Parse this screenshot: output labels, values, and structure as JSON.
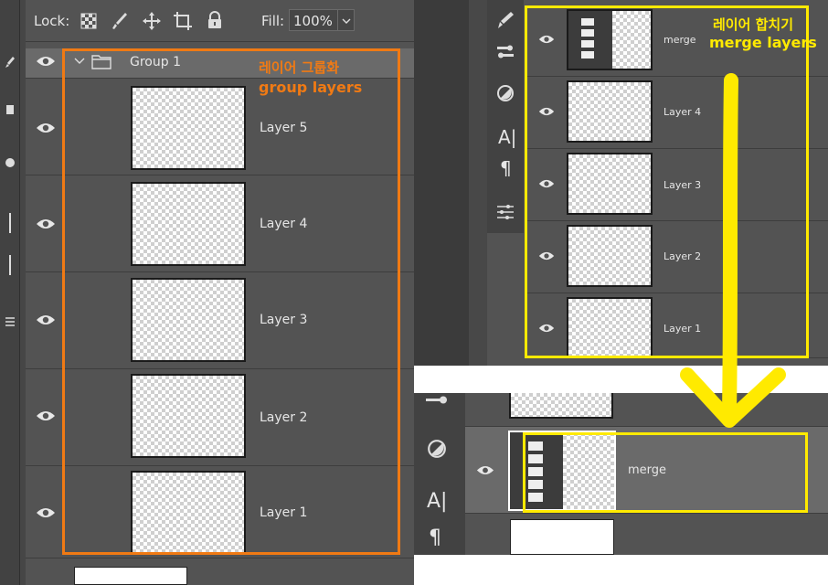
{
  "left_panel": {
    "lock_label": "Lock:",
    "fill_label": "Fill:",
    "fill_value": "100%",
    "group_name": "Group 1",
    "layers": [
      "Layer 5",
      "Layer 4",
      "Layer 3",
      "Layer 2",
      "Layer 1"
    ],
    "annotation_ko": "레이어 그룹화",
    "annotation_en": "group layers",
    "annotation_color": "#f07a14"
  },
  "right_top": {
    "layers": [
      "merge",
      "Layer 4",
      "Layer 3",
      "Layer 2",
      "Layer 1"
    ],
    "annotation_ko": "레이어 합치기",
    "annotation_en": "merge layers",
    "annotation_color": "#ffea00"
  },
  "right_bottom": {
    "merged_layer": "merge"
  },
  "icons": [
    "eye-icon",
    "folder-icon",
    "chevron-down-icon",
    "lock-icon",
    "brush-icon",
    "move-icon",
    "crop-icon",
    "text-icon",
    "paragraph-icon",
    "adjust-icon"
  ]
}
